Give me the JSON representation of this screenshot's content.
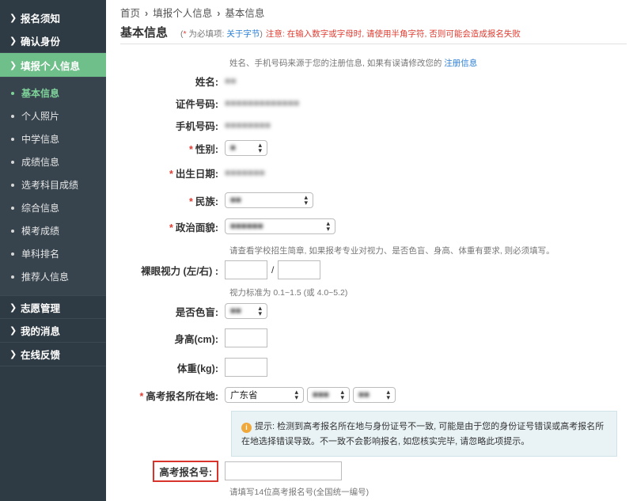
{
  "sidebar": {
    "top_items": [
      {
        "label": "报名须知"
      },
      {
        "label": "确认身份"
      },
      {
        "label": "填报个人信息"
      }
    ],
    "sub_items": [
      {
        "label": "基本信息"
      },
      {
        "label": "个人照片"
      },
      {
        "label": "中学信息"
      },
      {
        "label": "成绩信息"
      },
      {
        "label": "选考科目成绩"
      },
      {
        "label": "综合信息"
      },
      {
        "label": "模考成绩"
      },
      {
        "label": "单科排名"
      },
      {
        "label": "推荐人信息"
      }
    ],
    "bottom_items": [
      {
        "label": "志愿管理"
      },
      {
        "label": "我的消息"
      },
      {
        "label": "在线反馈"
      }
    ],
    "active_top": "填报个人信息",
    "active_sub": "基本信息",
    "colors": {
      "bg": "#2f3b44",
      "active": "#6fbf8a",
      "active_sub_text": "#7fd39a"
    }
  },
  "breadcrumb": {
    "items": [
      "首页",
      "填报个人信息",
      "基本信息"
    ]
  },
  "header": {
    "title": "基本信息",
    "required_star": "*",
    "required_note": " 为必填项: ",
    "about_link": "关于字节",
    "close_paren": ")",
    "warning": "注意: 在输入数字或字母时, 请使用半角字符, 否则可能会造成报名失败"
  },
  "form": {
    "source_note": "姓名、手机号码来源于您的注册信息, 如果有误请修改您的 ",
    "source_link": "注册信息",
    "name_label": "姓名:",
    "id_label": "证件号码:",
    "phone_label": "手机号码:",
    "gender_label": "性别:",
    "birth_label": "出生日期:",
    "ethnic_label": "民族:",
    "political_label": "政治面貌:",
    "vision_note": "请查看学校招生简章, 如果报考专业对视力、是否色盲、身高、体重有要求, 则必须填写。",
    "vision_label": "裸眼视力 (左/右) :",
    "vision_sep": "/",
    "vision_hint": "视力标准为 0.1~1.5 (或 4.0~5.2)",
    "colorblind_label": "是否色盲:",
    "height_label": "身高(cm):",
    "weight_label": "体重(kg):",
    "exam_location_label": "高考报名所在地:",
    "province_selected": "广东省",
    "notice_prefix": "提示: 检测到高考报名所在地与身份证号不一致, 可能是由于您的身份证号错误或高考报名所在地选择错误导致。不一致不会影响报名, 如您核实完毕, 请忽略此项提示。",
    "exam_number_label": "高考报名号:",
    "exam_number_hint": "请填写14位高考报名号(全国统一编号)",
    "required_star": "*"
  },
  "colors": {
    "required": "#e03c31",
    "link": "#2a7fd6",
    "notice_bg": "#e9f3f6",
    "highlight_border": "#d9342b"
  }
}
